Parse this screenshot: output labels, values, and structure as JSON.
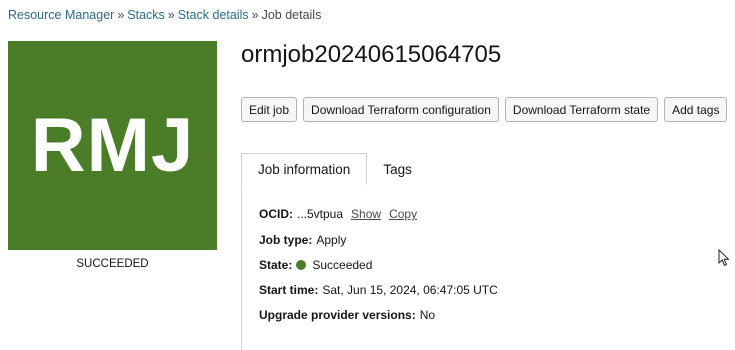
{
  "breadcrumb": {
    "items": [
      "Resource Manager",
      "Stacks",
      "Stack details"
    ],
    "separator": "»",
    "current": "Job details"
  },
  "avatar": {
    "initials": "RMJ",
    "color": "#4b7d28",
    "status": "SUCCEEDED"
  },
  "header": {
    "title": "ormjob20240615064705"
  },
  "actions": {
    "edit_job": "Edit job",
    "download_tf_config": "Download Terraform configuration",
    "download_tf_state": "Download Terraform state",
    "add_tags": "Add tags"
  },
  "tabs": [
    {
      "label": "Job information",
      "active": true
    },
    {
      "label": "Tags",
      "active": false
    }
  ],
  "job_info": {
    "ocid_label": "OCID:",
    "ocid_value": "...5vtpua",
    "ocid_show": "Show",
    "ocid_copy": "Copy",
    "job_type_label": "Job type:",
    "job_type_value": "Apply",
    "state_label": "State:",
    "state_value": "Succeeded",
    "state_color": "#4b7d28",
    "start_time_label": "Start time:",
    "start_time_value": "Sat, Jun 15, 2024, 06:47:05 UTC",
    "upgrade_label": "Upgrade provider versions:",
    "upgrade_value": "No"
  },
  "icons": {
    "cursor": "mouse-pointer-icon",
    "state": "status-dot-icon"
  }
}
